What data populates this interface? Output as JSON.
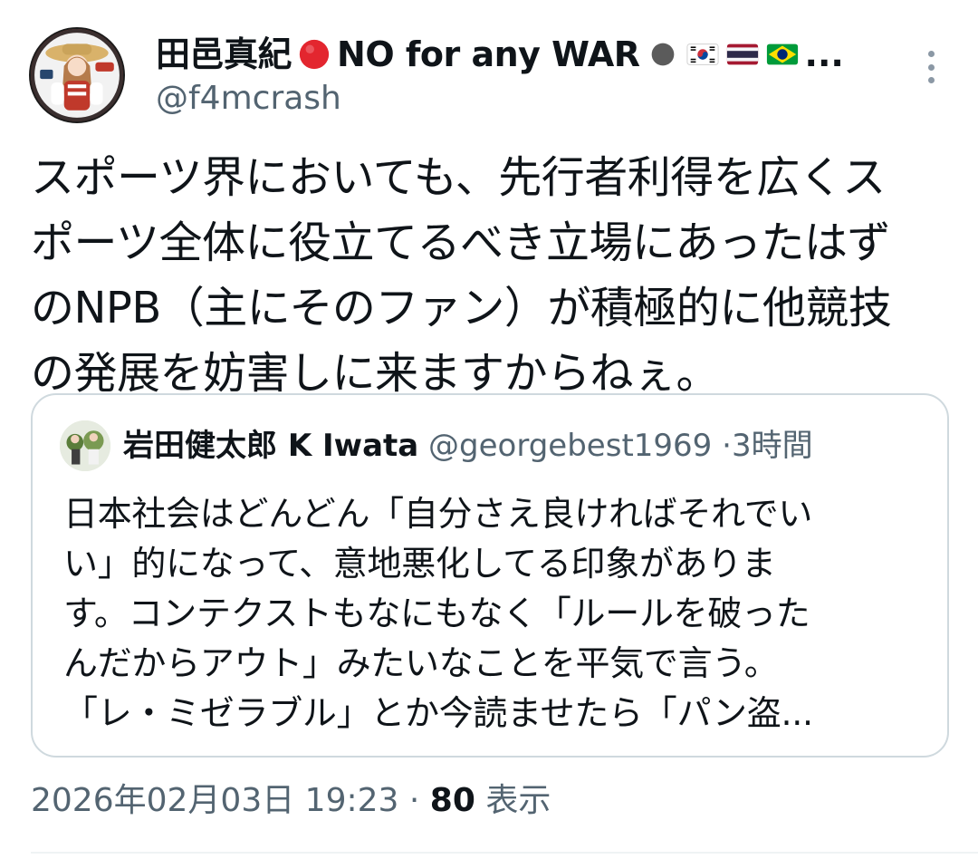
{
  "author": {
    "display_name": "田邑真紀🔴NO for any WAR⚫",
    "display_name_text": "田邑真紀",
    "display_name_suffix": "NO for any WAR",
    "flags": [
      "flag-south-korea-icon",
      "flag-thailand-icon",
      "flag-brazil-icon"
    ],
    "truncation": "...",
    "handle": "@f4mcrash"
  },
  "tweet": {
    "lines": [
      "スポーツ界においても、先行者利得を広くス",
      "ポーツ全体に役立てるべき立場にあったはず",
      "のNPB（主にそのファン）が積極的に他競技",
      "の発展を妨害しに来ますからねぇ。"
    ]
  },
  "quote": {
    "name": "岩田健太郎 K Iwata",
    "handle": "@georgebest1969",
    "separator": "·",
    "time": "3時間",
    "lines": [
      "日本社会はどんどん「自分さえ良ければそれでい",
      "い」的になって、意地悪化してる印象がありま",
      "す。コンテクストもなにもなく「ルールを破った",
      "んだからアウト」みたいなことを平気で言う。",
      "「レ・ミゼラブル」とか今読ませたら「パン盗..."
    ]
  },
  "footer": {
    "timestamp": "2026年02月03日 19:23",
    "separator": "·",
    "views_count": "80",
    "views_label": "表示"
  },
  "colors": {
    "text": "#0f1419",
    "secondary": "#536471",
    "border": "#cfd9de",
    "background": "#ffffff"
  }
}
